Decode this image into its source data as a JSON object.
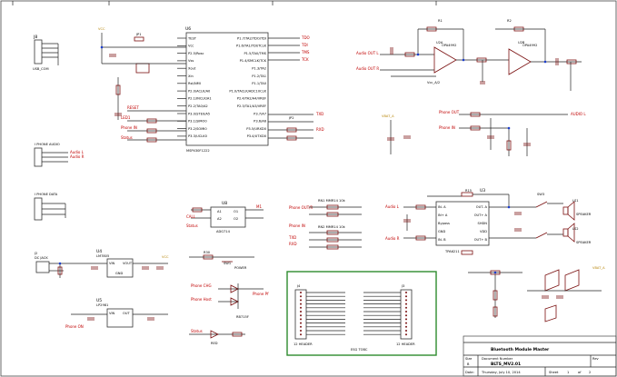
{
  "title_block": {
    "size_label": "Size",
    "size_value": "B",
    "docnum_label": "Document Number",
    "docnum_value": "BLTS_MV2.01",
    "rev_label": "Rev",
    "date_label": "Date:",
    "date_value": "Thursday, July 10, 2014",
    "sheet_label": "Sheet",
    "sheet_of": "of",
    "sheet_value": "1",
    "sheet_total": "2",
    "project_title": "Bluetooth Module Master"
  },
  "connectors": {
    "j8": "J8",
    "j8_name": "USB_COM",
    "j7_name": "I PHONE AUDIO",
    "j6_name": "I PHONE DATA",
    "j2": "J2",
    "j2_name": "DC JACK",
    "j4": "J4",
    "j3": "J3",
    "j4_name": "12 HEADER",
    "j3_name": "12 HEADER",
    "box_caption": "ESG TOBC"
  },
  "mcu": {
    "ref": "U6",
    "part": "MSP430F1222",
    "jp": "JP1",
    "left_pins": [
      "TEST",
      "Vcc",
      "P2.5/Rosc",
      "Vss",
      "Xout",
      "Xin",
      "Rst/NMI",
      "P2.0/ACLK/A0",
      "P2.1/INCLK/A1",
      "P2.2/TA0/A2",
      "P3.0/STE0/A5",
      "P3.1/SIMO0",
      "P3.2/SOMI0",
      "P3.3/UCLK0"
    ],
    "right_pins": [
      "P1.7/TA2/TDO/TDI",
      "P1.6/TA1/TDI/TCLK",
      "P1.5/TA0/TMS",
      "P1.4/SMCLK/TCK",
      "P1.3/TA2",
      "P1.2/TA1",
      "P1.1/TA0",
      "P1.0/TACLK/ADC10CLK",
      "P2.4/TA2/A4/VREF",
      "P2.3/TA1/A3/VREF",
      "P3.7/A7",
      "P3.6/A6",
      "P3.5/URXD0",
      "P3.4/UTXD0"
    ]
  },
  "opamps": {
    "u2a": "U2A",
    "u2a_part": "OPA4992",
    "u2b": "U2B",
    "u2b_part": "OPA4992",
    "audio_out_l": "Audio OUT L",
    "audio_out_r": "Audio OUT R"
  },
  "amp": {
    "ref": "U3",
    "part": "TPA6211",
    "pins_left": [
      "IN- A",
      "IN+ A",
      "Bypass",
      "GND",
      "IN- B"
    ],
    "pins_right": [
      "OUT- A",
      "OUT+ A",
      "SHDN",
      "VDD",
      "OUT+ B"
    ],
    "speaker1": "SPEAKER",
    "speaker2": "SPEAKER",
    "ls1": "LS1",
    "ls2": "LS2",
    "switch": "SW3"
  },
  "regulators": {
    "u4": "U4",
    "u4_part": "LM7805",
    "u5": "U5",
    "u5_part": "LP2981",
    "u8": "U8",
    "u8_part": "ADG714",
    "sw1": "SW1",
    "power": "POWER"
  },
  "nets": {
    "vcc": "VCC",
    "vbat": "VBAT_A",
    "audio_l": "AUDIO L",
    "audio_r": "AUDIO R",
    "phone_out": "Phone OUT",
    "phone_in": "Phone IN",
    "status": "Status",
    "call": "CALL",
    "reset": "RESET",
    "txd": "TXD",
    "rxd": "RXD",
    "led": "LED1",
    "red": "RED",
    "pwr_led": "PWR LED"
  }
}
